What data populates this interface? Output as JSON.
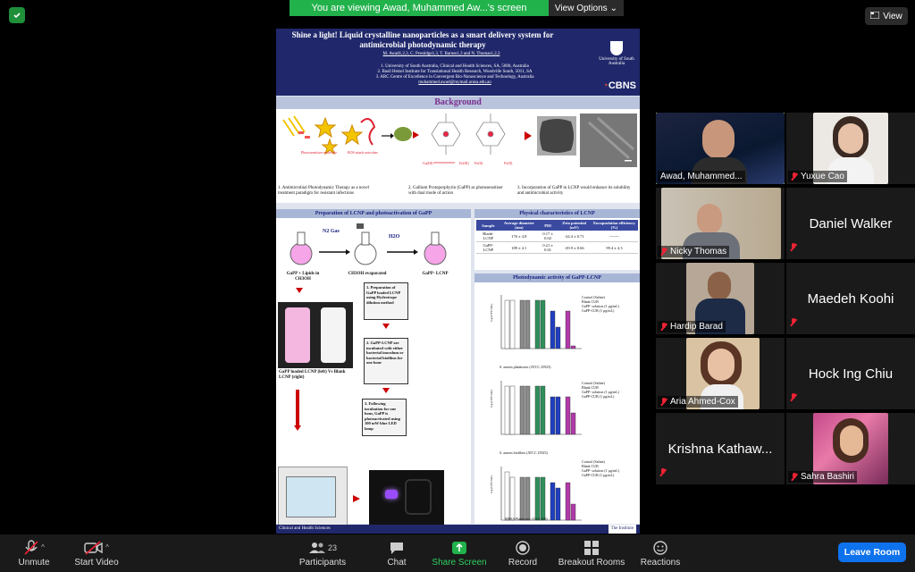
{
  "top": {
    "banner_text": "You are viewing Awad, Muhammed Aw...'s screen",
    "view_options_label": "View Options",
    "view_label": "View"
  },
  "poster": {
    "title": "Shine a light! Liquid crystalline nanoparticles as a smart delivery system for antimicrobial photodynamic therapy",
    "authors": "M. Awad1,2,3, C. Prestidge1,3, T. Barnes1,3 and N. Thomas1,2,3",
    "affiliations": [
      "1. University of South Australia, Clinical and Health Sciences, SA, 5000, Australia",
      "2. Basil Hetzel Institute for Translational Health Research, Woodville South, 5011, SA",
      "3. ARC Centre of Excellence in Convergent Bio-Nanoscience and Technology, Australia",
      "muhammed.awad@mymail.unisa.edu.au"
    ],
    "uni_name": "University of South Australia",
    "cbns": "CBNS",
    "background_heading": "Background",
    "bg_captions": [
      "1. Antimicrobial Photodynamic Therapy as a novel treatment paradigm for resistant infections",
      "2. Gallium Protoporphyrin (GaPP) as photosensitiser with dual mode of action",
      "3. Incorporation of GaPP in LCNP would enhance its solubility and antimicrobial activity"
    ],
    "prep_heading": "Preparation of LCNP and photoactivation of GaPP",
    "phys_heading": "Physical characteristics of LCNP",
    "pdt_heading": "Photodynamic activity of GaPP-LCNP",
    "flask_labels": [
      "GaPP + Lipids in CH3OH",
      "CH3OH evaporated",
      "GaPP- LCNP"
    ],
    "n2_label": "N2 Gas",
    "h2o_label": "H2O",
    "vial_caption": "GaPP loaded LCNP (left) Vs Blank LCNP (right)",
    "steps": [
      "1. Preparation of GaPP loaded LCNP using Hydrotrope dilution method",
      "2. GaPP-LCNP are incubated with either bacterial inoculum or bacterial biofilms for one hour",
      "3. Following incubation for one hour, GaPP is photoactivated using 100 mW blue LED lamp"
    ],
    "table": {
      "headers": [
        "Sample",
        "Average diameter (nm)",
        "PDI",
        "Zeta potential (mV)",
        "Encapsulation efficiency (%)"
      ],
      "rows": [
        [
          "Blank- LCNP",
          "176 ± 4.8",
          "0.17 ± 0.02",
          "-24.4 ± 0.71",
          "-------"
        ],
        [
          "GaPP- LCNP",
          "189 ± 4.1",
          "0.21 ± 0.01",
          "-29.9 ± 0.66",
          "99.4 ± 4.3"
        ]
      ]
    },
    "legend": [
      "Control (Saline)",
      "Blank CUB",
      "GaPP- solution (1 µg/mL)",
      "GaPP-CUB (1 µg/mL)"
    ],
    "chart_titles": [
      "S. aureus planktonic (ATCC 25923)",
      "S. aureus biofilms (ATCC 25923)",
      "MRSA Planktonic (USA 300)"
    ],
    "ylabel": "log (CFU/mL)",
    "footer": "Clinical and Health Sciences",
    "footer_right": "The Institute"
  },
  "participants": [
    {
      "name": "Awad, Muhammed...",
      "kind": "video",
      "muted": false,
      "active": true
    },
    {
      "name": "Yuxue Cao",
      "kind": "video",
      "muted": true
    },
    {
      "name": "Nicky Thomas",
      "kind": "video",
      "muted": true
    },
    {
      "name": "Daniel Walker",
      "kind": "name",
      "muted": true
    },
    {
      "name": "Hardip Barad",
      "kind": "video",
      "muted": true
    },
    {
      "name": "Maedeh Koohi",
      "kind": "name",
      "muted": true
    },
    {
      "name": "Aria Ahmed-Cox",
      "kind": "video",
      "muted": true
    },
    {
      "name": "Hock Ing Chiu",
      "kind": "name",
      "muted": true
    },
    {
      "name": "Krishna Kathaw...",
      "kind": "name",
      "muted": true
    },
    {
      "name": "Sahra Bashiri",
      "kind": "video",
      "muted": true
    }
  ],
  "toolbar": {
    "unmute": "Unmute",
    "start_video": "Start Video",
    "participants": "Participants",
    "participants_count": "23",
    "chat": "Chat",
    "share_screen": "Share Screen",
    "record": "Record",
    "breakout_rooms": "Breakout Rooms",
    "reactions": "Reactions",
    "leave_room": "Leave Room"
  },
  "colors": {
    "share_green": "#22b24c",
    "leave_blue": "#0e72ed",
    "active_speaker": "#e6e84f",
    "poster_navy": "#20286b"
  }
}
